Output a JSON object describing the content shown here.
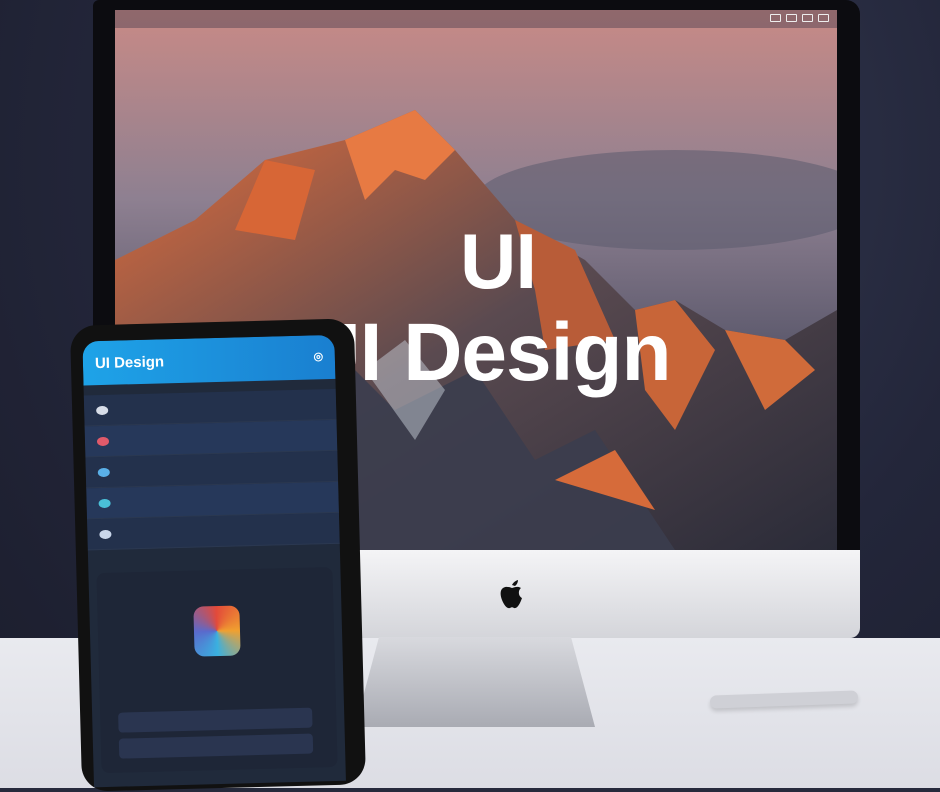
{
  "desktop": {
    "menu_items": [
      "",
      "",
      "",
      "",
      "",
      "",
      "",
      "",
      ""
    ],
    "headline_line1": "UI",
    "headline_line2": "UI Design"
  },
  "phone_app": {
    "title": "UI Design",
    "section_label": "",
    "rows": [
      "",
      "",
      "",
      "",
      ""
    ],
    "card": {
      "title": "",
      "subtitle": "",
      "field1": "",
      "field2": ""
    }
  },
  "colors": {
    "accent": "#1ea3e8",
    "mountain_glow": "#e06a35",
    "sky_top": "#d18e86"
  }
}
